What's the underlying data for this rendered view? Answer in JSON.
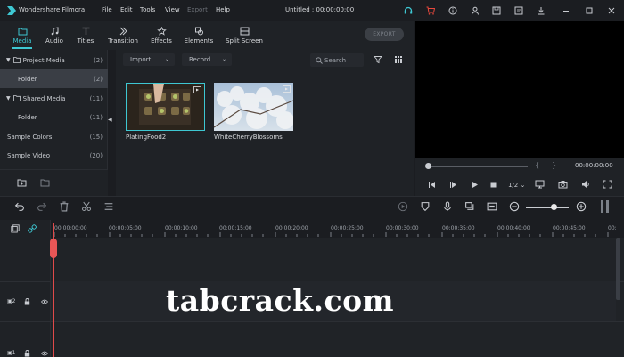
{
  "app": {
    "name": "Wondershare Filmora",
    "document_title": "Untitled : 00:00:00:00",
    "brand_color": "#3ec7d2"
  },
  "menu": [
    "File",
    "Edit",
    "Tools",
    "View",
    "Export",
    "Help"
  ],
  "toolbar": {
    "tabs": [
      "Media",
      "Audio",
      "Titles",
      "Transition",
      "Effects",
      "Elements",
      "Split Screen"
    ],
    "active_tab": "Media",
    "export_label": "EXPORT"
  },
  "sidebar": {
    "items": [
      {
        "label": "Project Media",
        "count": "(2)"
      },
      {
        "label": "Folder",
        "count": "(2)"
      },
      {
        "label": "Shared Media",
        "count": "(11)"
      },
      {
        "label": "Folder",
        "count": "(11)"
      },
      {
        "label": "Sample Colors",
        "count": "(15)"
      },
      {
        "label": "Sample Video",
        "count": "(20)"
      }
    ]
  },
  "media": {
    "import_label": "Import",
    "record_label": "Record",
    "search_placeholder": "Search",
    "clips": [
      {
        "name": "PlatingFood2"
      },
      {
        "name": "WhiteCherryBlossoms"
      }
    ]
  },
  "preview": {
    "timecode": "00:00:00:00",
    "quality": "1/2",
    "bracket_in": "{",
    "bracket_out": "}"
  },
  "timeline": {
    "ticks": [
      "00:00:00:00",
      "00:00:05:00",
      "00:00:10:00",
      "00:00:15:00",
      "00:00:20:00",
      "00:00:25:00",
      "00:00:30:00",
      "00:00:35:00",
      "00:00:40:00",
      "00:00:45:00",
      "00:"
    ],
    "track_labels": [
      "2",
      "1"
    ]
  },
  "watermark": "tabcrack.com"
}
